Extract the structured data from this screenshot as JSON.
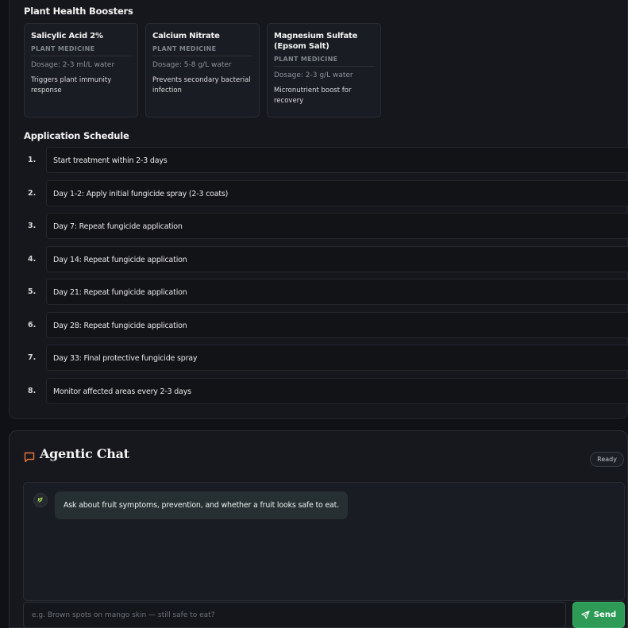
{
  "boosters": {
    "title": "Plant Health Boosters",
    "cards": [
      {
        "name": "Salicylic Acid 2%",
        "category": "PLANT MEDICINE",
        "dosage": "Dosage: 2-3 ml/L water",
        "description": "Triggers plant immunity response"
      },
      {
        "name": "Calcium Nitrate",
        "category": "PLANT MEDICINE",
        "dosage": "Dosage: 5-8 g/L water",
        "description": "Prevents secondary bacterial infection"
      },
      {
        "name": "Magnesium Sulfate (Epsom Salt)",
        "category": "PLANT MEDICINE",
        "dosage": "Dosage: 2-3 g/L water",
        "description": "Micronutrient boost for recovery"
      }
    ]
  },
  "schedule": {
    "title": "Application Schedule",
    "items": [
      {
        "num": "1.",
        "text": "Start treatment within 2-3 days"
      },
      {
        "num": "2.",
        "text": "Day 1-2: Apply initial fungicide spray (2-3 coats)"
      },
      {
        "num": "3.",
        "text": "Day 7: Repeat fungicide application"
      },
      {
        "num": "4.",
        "text": "Day 14: Repeat fungicide application"
      },
      {
        "num": "5.",
        "text": "Day 21: Repeat fungicide application"
      },
      {
        "num": "6.",
        "text": "Day 28: Repeat fungicide application"
      },
      {
        "num": "7.",
        "text": "Day 33: Final protective fungicide spray"
      },
      {
        "num": "8.",
        "text": "Monitor affected areas every 2-3 days"
      }
    ]
  },
  "chat": {
    "title": "Agentic Chat",
    "status": "Ready",
    "icon": "chat-bubble-icon",
    "accent_color": "#e8743b",
    "messages": [
      {
        "role": "bot",
        "icon": "leaf-icon",
        "text": "Ask about fruit symptoms, prevention, and whether a fruit looks safe to eat."
      }
    ],
    "input_placeholder": "e.g. Brown spots on mango skin — still safe to eat?",
    "input_value": "",
    "send_label": "Send",
    "send_icon": "send-icon",
    "send_color": "#2d9b56"
  }
}
